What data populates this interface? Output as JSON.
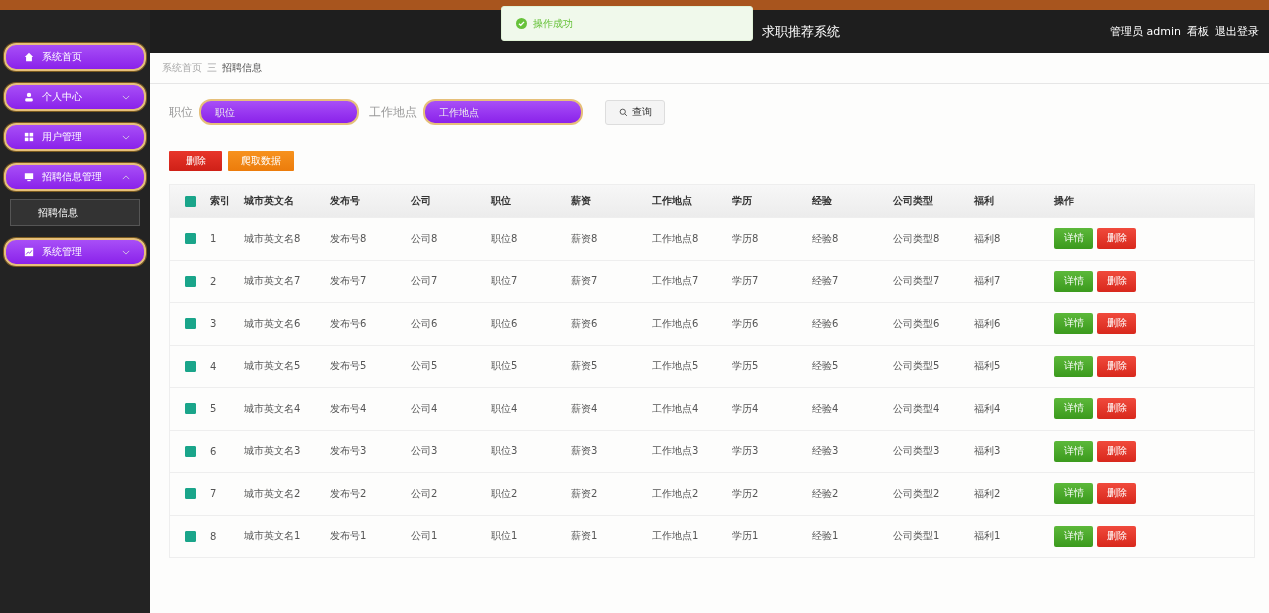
{
  "toast": {
    "text": "操作成功"
  },
  "header": {
    "title": "求职推荐系统",
    "user": "管理员 admin",
    "links": [
      "看板",
      "退出登录"
    ]
  },
  "sidebar": {
    "items": [
      {
        "kind": "link",
        "label": "系统首页"
      },
      {
        "kind": "menu",
        "label": "个人中心",
        "expanded": false
      },
      {
        "kind": "menu",
        "label": "用户管理",
        "expanded": false
      },
      {
        "kind": "menu",
        "label": "招聘信息管理",
        "expanded": true,
        "children": [
          {
            "label": "招聘信息"
          }
        ]
      },
      {
        "kind": "menu",
        "label": "系统管理",
        "expanded": false
      }
    ]
  },
  "breadcrumb": [
    "系统首页",
    "三",
    "招聘信息"
  ],
  "search": {
    "fields": [
      {
        "label": "职位",
        "placeholder": "职位"
      },
      {
        "label": "工作地点",
        "placeholder": "工作地点"
      }
    ],
    "button": "查询"
  },
  "actions": [
    "删除",
    "爬取数据"
  ],
  "table": {
    "all_checked": true,
    "columns": [
      "索引",
      "城市英文名",
      "发布号",
      "公司",
      "职位",
      "薪资",
      "工作地点",
      "学历",
      "经验",
      "公司类型",
      "福利",
      "操作"
    ],
    "rows": [
      {
        "checked": true,
        "cells": [
          "1",
          "城市英文名8",
          "发布号8",
          "公司8",
          "职位8",
          "薪资8",
          "工作地点8",
          "学历8",
          "经验8",
          "公司类型8",
          "福利8"
        ],
        "buttons": [
          "详情",
          "删除"
        ]
      },
      {
        "checked": true,
        "cells": [
          "2",
          "城市英文名7",
          "发布号7",
          "公司7",
          "职位7",
          "薪资7",
          "工作地点7",
          "学历7",
          "经验7",
          "公司类型7",
          "福利7"
        ],
        "buttons": [
          "详情",
          "删除"
        ]
      },
      {
        "checked": true,
        "cells": [
          "3",
          "城市英文名6",
          "发布号6",
          "公司6",
          "职位6",
          "薪资6",
          "工作地点6",
          "学历6",
          "经验6",
          "公司类型6",
          "福利6"
        ],
        "buttons": [
          "详情",
          "删除"
        ]
      },
      {
        "checked": true,
        "cells": [
          "4",
          "城市英文名5",
          "发布号5",
          "公司5",
          "职位5",
          "薪资5",
          "工作地点5",
          "学历5",
          "经验5",
          "公司类型5",
          "福利5"
        ],
        "buttons": [
          "详情",
          "删除"
        ]
      },
      {
        "checked": true,
        "cells": [
          "5",
          "城市英文名4",
          "发布号4",
          "公司4",
          "职位4",
          "薪资4",
          "工作地点4",
          "学历4",
          "经验4",
          "公司类型4",
          "福利4"
        ],
        "buttons": [
          "详情",
          "删除"
        ]
      },
      {
        "checked": true,
        "cells": [
          "6",
          "城市英文名3",
          "发布号3",
          "公司3",
          "职位3",
          "薪资3",
          "工作地点3",
          "学历3",
          "经验3",
          "公司类型3",
          "福利3"
        ],
        "buttons": [
          "详情",
          "删除"
        ]
      },
      {
        "checked": true,
        "cells": [
          "7",
          "城市英文名2",
          "发布号2",
          "公司2",
          "职位2",
          "薪资2",
          "工作地点2",
          "学历2",
          "经验2",
          "公司类型2",
          "福利2"
        ],
        "buttons": [
          "详情",
          "删除"
        ]
      },
      {
        "checked": true,
        "cells": [
          "8",
          "城市英文名1",
          "发布号1",
          "公司1",
          "职位1",
          "薪资1",
          "工作地点1",
          "学历1",
          "经验1",
          "公司类型1",
          "福利1"
        ],
        "buttons": [
          "详情",
          "删除"
        ]
      }
    ]
  }
}
